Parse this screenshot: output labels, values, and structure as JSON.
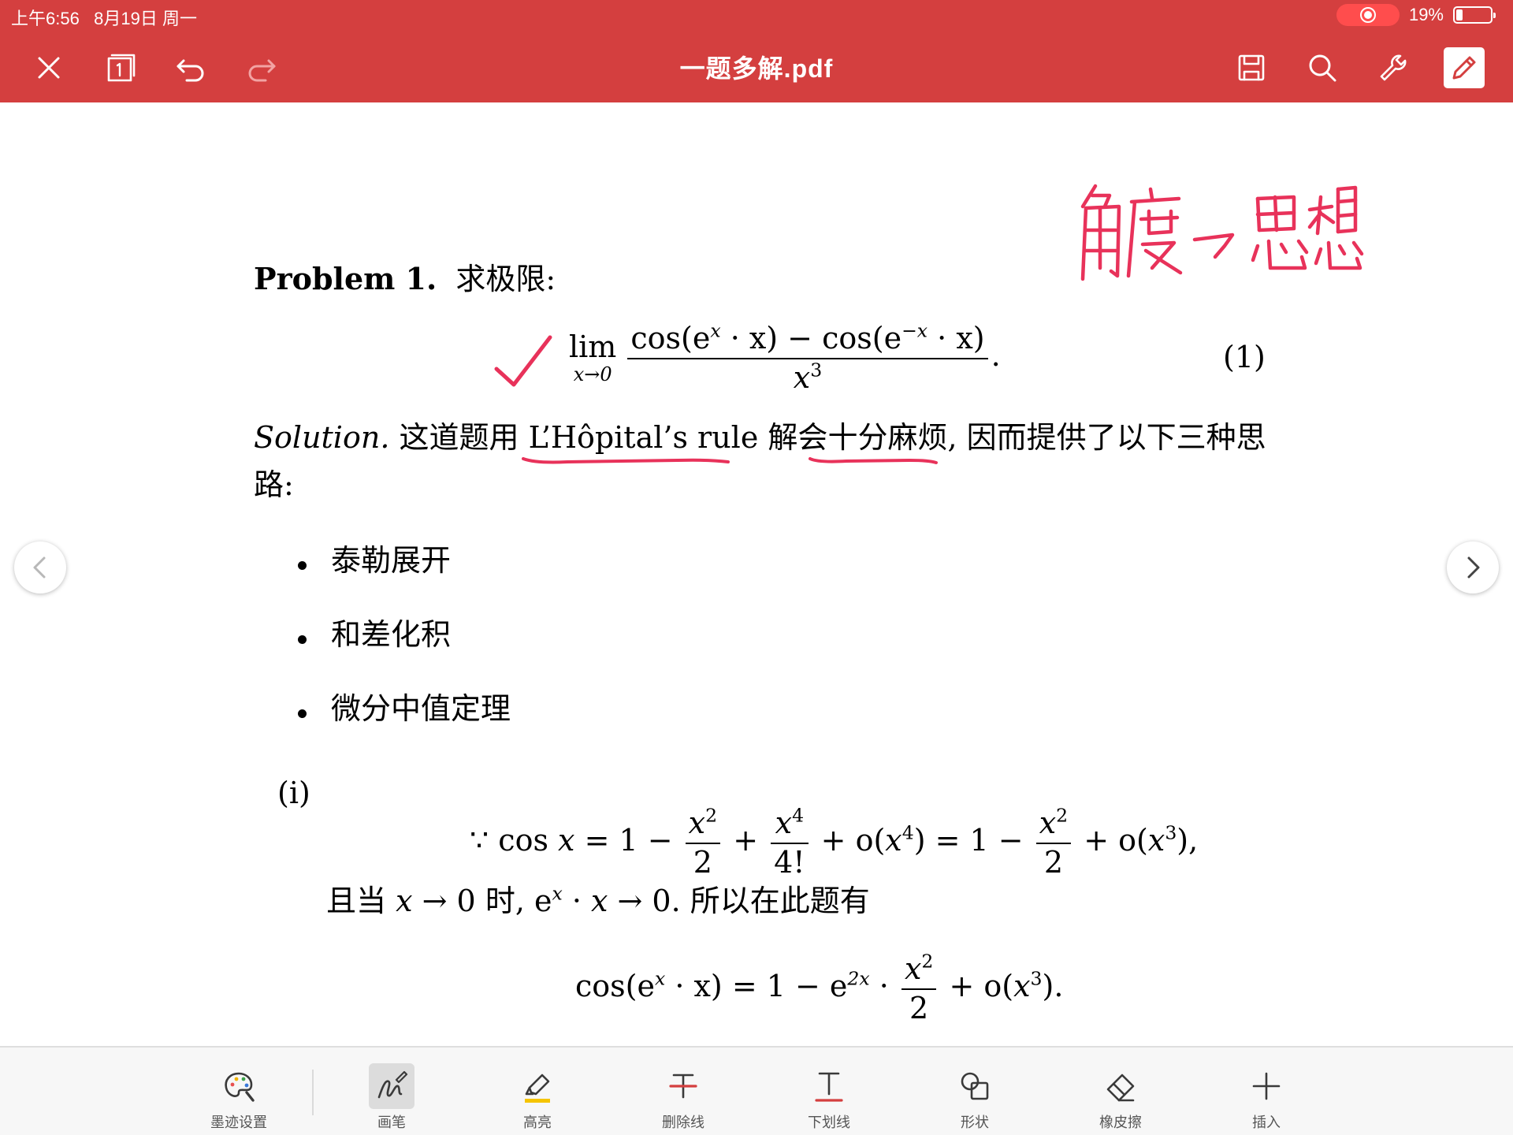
{
  "status_bar": {
    "time": "上午6:56",
    "date": "8月19日 周一",
    "battery_percent": "19%",
    "battery_level": 0.19
  },
  "toolbar": {
    "title": "一题多解.pdf",
    "page_icon_number": "1"
  },
  "colors": {
    "header_red": "#d43f3f",
    "ink_red": "#e8325a",
    "pencil_yellow": "#f5c400"
  },
  "document": {
    "handwriting_note": "角度 → 思想",
    "problem": {
      "label": "Problem 1.",
      "text": "求极限:"
    },
    "eq1": {
      "lim": "lim",
      "lim_sub": "x→0",
      "num_a": "cos(e",
      "num_a_sup": "x",
      "num_b": " · x) − cos(e",
      "num_b_sup": "−x",
      "num_c": " · x)",
      "den": "x",
      "den_sup": "3",
      "end": ".",
      "number": "(1)"
    },
    "solution": {
      "label": "Solution.",
      "seg1": "这道题用",
      "seg2": "L’Hôpital’s rule",
      "seg3": "解会",
      "seg4": "十分麻烦",
      "seg5": ", 因而提供了以下三种思",
      "line2": "路:"
    },
    "methods": [
      "泰勒展开",
      "和差化积",
      "微分中值定理"
    ],
    "part_i": {
      "label": "(i)",
      "eq2": {
        "because": "∵",
        "cos": "cos",
        "x": "x",
        "eq1": " = 1 − ",
        "frac1_num": "x",
        "frac1_sup": "2",
        "frac1_den": "2",
        "plus": "+",
        "frac2_num": "x",
        "frac2_sup": "4",
        "frac2_den": "4!",
        "small_o_a": "+ o(",
        "small_o_a_sup": "4",
        "small_o_a_end": ")",
        "eq2": " = 1 − ",
        "frac3_num": "x",
        "frac3_sup": "2",
        "frac3_den": "2",
        "small_o_b": "+ o(",
        "small_o_b_sup": "3",
        "small_o_b_end": "),"
      },
      "line": {
        "a": "且当",
        "b": "x",
        "c": "→ 0 时, e",
        "d": "x",
        "e": " · ",
        "f": "x",
        "g": " → 0. 所以在此题有"
      },
      "eq3": {
        "lhs_a": "cos(e",
        "lhs_sup": "x",
        "lhs_b": " · x) = 1 − e",
        "e_sup": "2x",
        "dot": " · ",
        "frac_num": "x",
        "frac_sup": "2",
        "frac_den": "2",
        "tail": "+ o(",
        "tail_sup": "3",
        "tail_end": ")."
      }
    }
  },
  "bottom_tools": [
    {
      "label": "墨迹设置",
      "icon": "palette-icon"
    },
    {
      "label": "画笔",
      "icon": "pen-icon",
      "active": true
    },
    {
      "label": "高亮",
      "icon": "highlighter-icon"
    },
    {
      "label": "删除线",
      "icon": "strikethrough-icon"
    },
    {
      "label": "下划线",
      "icon": "underline-icon"
    },
    {
      "label": "形状",
      "icon": "shapes-icon"
    },
    {
      "label": "橡皮擦",
      "icon": "eraser-icon"
    },
    {
      "label": "插入",
      "icon": "plus-icon"
    }
  ]
}
